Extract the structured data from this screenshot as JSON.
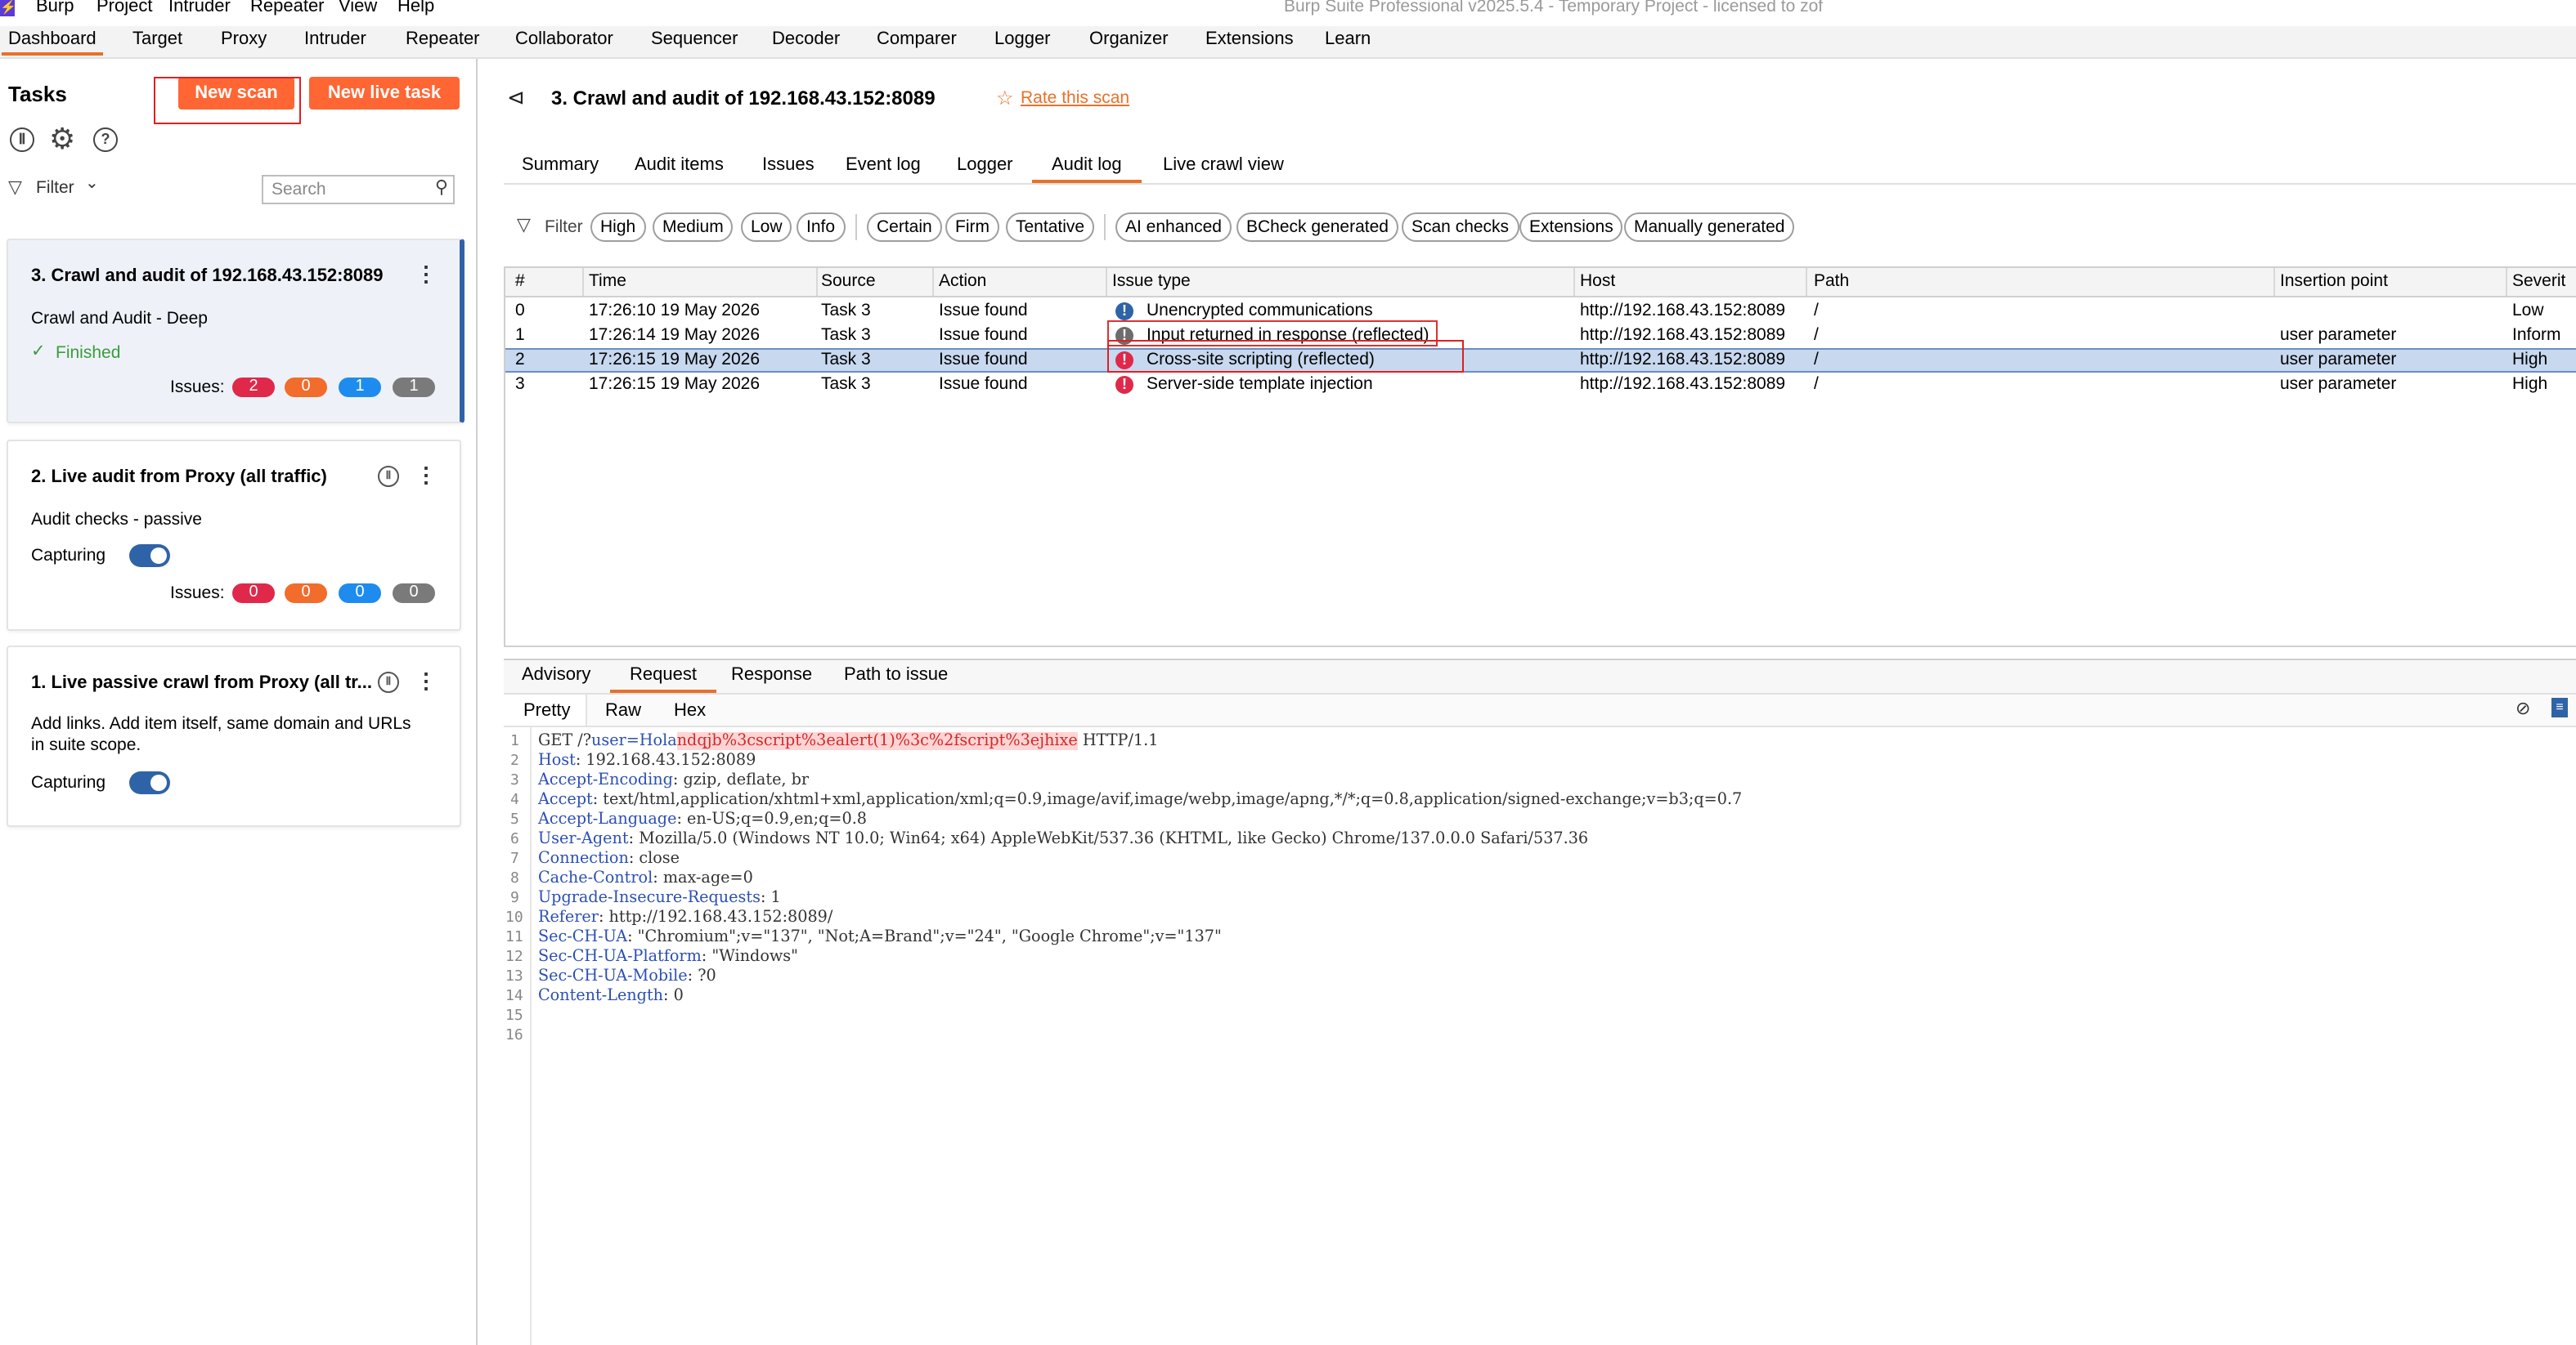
{
  "window": {
    "title": "Burp Suite Professional v2025.5.4 - Temporary Project - licensed to zof",
    "menus": [
      "Burp",
      "Project",
      "Intruder",
      "Repeater",
      "View",
      "Help"
    ]
  },
  "top_tabs": [
    "Dashboard",
    "Target",
    "Proxy",
    "Intruder",
    "Repeater",
    "Collaborator",
    "Sequencer",
    "Decoder",
    "Comparer",
    "Logger",
    "Organizer",
    "Extensions",
    "Learn"
  ],
  "tasks_panel": {
    "title": "Tasks",
    "new_scan": "New scan",
    "new_live_task": "New live task",
    "filter": "Filter",
    "search_placeholder": "Search",
    "issues_label": "Issues:",
    "tasks": [
      {
        "title": "3. Crawl and audit of 192.168.43.152:8089",
        "subtitle": "Crawl and Audit - Deep",
        "status": "Finished",
        "issues": [
          "2",
          "0",
          "1",
          "1"
        ]
      },
      {
        "title": "2. Live audit from Proxy (all traffic)",
        "subtitle": "Audit checks - passive",
        "status": "Capturing",
        "issues": [
          "0",
          "0",
          "0",
          "0"
        ]
      },
      {
        "title": "1. Live passive crawl from Proxy (all tr...",
        "subtitle_line1": "Add links. Add item itself, same domain and URLs",
        "subtitle_line2": "in suite scope.",
        "status": "Capturing"
      }
    ]
  },
  "colors": {
    "accent": "#ff6633",
    "high": "#e0284a",
    "medium": "#f26c2b",
    "low": "#1e8cef",
    "info": "#7a7a7a",
    "selected_row": "#c7d8ef"
  },
  "scan": {
    "title": "3. Crawl and audit of 192.168.43.152:8089",
    "rate": "Rate this scan",
    "tabs": [
      "Summary",
      "Audit items",
      "Issues",
      "Event log",
      "Logger",
      "Audit log",
      "Live crawl view"
    ],
    "filter_label": "Filter",
    "filters": [
      "High",
      "Medium",
      "Low",
      "Info",
      "Certain",
      "Firm",
      "Tentative",
      "AI enhanced",
      "BCheck generated",
      "Scan checks",
      "Extensions",
      "Manually generated"
    ]
  },
  "audit_log": {
    "columns": [
      "#",
      "Time",
      "Source",
      "Action",
      "Issue type",
      "Host",
      "Path",
      "Insertion point",
      "Severit"
    ],
    "rows": [
      {
        "num": "0",
        "time": "17:26:10 19 May 2026",
        "source": "Task 3",
        "action": "Issue found",
        "severity_icon": "info",
        "issue": "Unencrypted communications",
        "host": "http://192.168.43.152:8089",
        "path": "/",
        "insertion": "",
        "severity": "Low"
      },
      {
        "num": "1",
        "time": "17:26:14 19 May 2026",
        "source": "Task 3",
        "action": "Issue found",
        "severity_icon": "gray",
        "issue": "Input returned in response (reflected)",
        "host": "http://192.168.43.152:8089",
        "path": "/",
        "insertion": "user parameter",
        "severity": "Inform"
      },
      {
        "num": "2",
        "time": "17:26:15 19 May 2026",
        "source": "Task 3",
        "action": "Issue found",
        "severity_icon": "high",
        "issue": "Cross-site scripting (reflected)",
        "host": "http://192.168.43.152:8089",
        "path": "/",
        "insertion": "user parameter",
        "severity": "High"
      },
      {
        "num": "3",
        "time": "17:26:15 19 May 2026",
        "source": "Task 3",
        "action": "Issue found",
        "severity_icon": "high",
        "issue": "Server-side template injection",
        "host": "http://192.168.43.152:8089",
        "path": "/",
        "insertion": "user parameter",
        "severity": "High"
      }
    ]
  },
  "detail_tabs": [
    "Advisory",
    "Request",
    "Response",
    "Path to issue"
  ],
  "editor_tabs": [
    "Pretty",
    "Raw",
    "Hex"
  ],
  "request": {
    "line1": {
      "method": "GET /?",
      "param": "user=Hola",
      "payload": "ndqjb%3cscript%3ealert(1)%3c%2fscript%3ejhixe",
      "version": " HTTP/1.1"
    },
    "headers": [
      {
        "name": "Host",
        "value": ": 192.168.43.152:8089"
      },
      {
        "name": "Accept-Encoding",
        "value": ": gzip, deflate, br"
      },
      {
        "name": "Accept",
        "value": ": text/html,application/xhtml+xml,application/xml;q=0.9,image/avif,image/webp,image/apng,*/*;q=0.8,application/signed-exchange;v=b3;q=0.7"
      },
      {
        "name": "Accept-Language",
        "value": ": en-US;q=0.9,en;q=0.8"
      },
      {
        "name": "User-Agent",
        "value": ": Mozilla/5.0 (Windows NT 10.0; Win64; x64) AppleWebKit/537.36 (KHTML, like Gecko) Chrome/137.0.0.0 Safari/537.36"
      },
      {
        "name": "Connection",
        "value": ": close"
      },
      {
        "name": "Cache-Control",
        "value": ": max-age=0"
      },
      {
        "name": "Upgrade-Insecure-Requests",
        "value": ": 1"
      },
      {
        "name": "Referer",
        "value": ": http://192.168.43.152:8089/"
      },
      {
        "name": "Sec-CH-UA",
        "value": ": \"Chromium\";v=\"137\", \"Not;A=Brand\";v=\"24\", \"Google Chrome\";v=\"137\""
      },
      {
        "name": "Sec-CH-UA-Platform",
        "value": ": \"Windows\""
      },
      {
        "name": "Sec-CH-UA-Mobile",
        "value": ": ?0"
      },
      {
        "name": "Content-Length",
        "value": ": 0"
      }
    ],
    "line_numbers": [
      "1",
      "2",
      "3",
      "4",
      "5",
      "6",
      "7",
      "8",
      "9",
      "10",
      "11",
      "12",
      "13",
      "14",
      "15",
      "16"
    ]
  }
}
